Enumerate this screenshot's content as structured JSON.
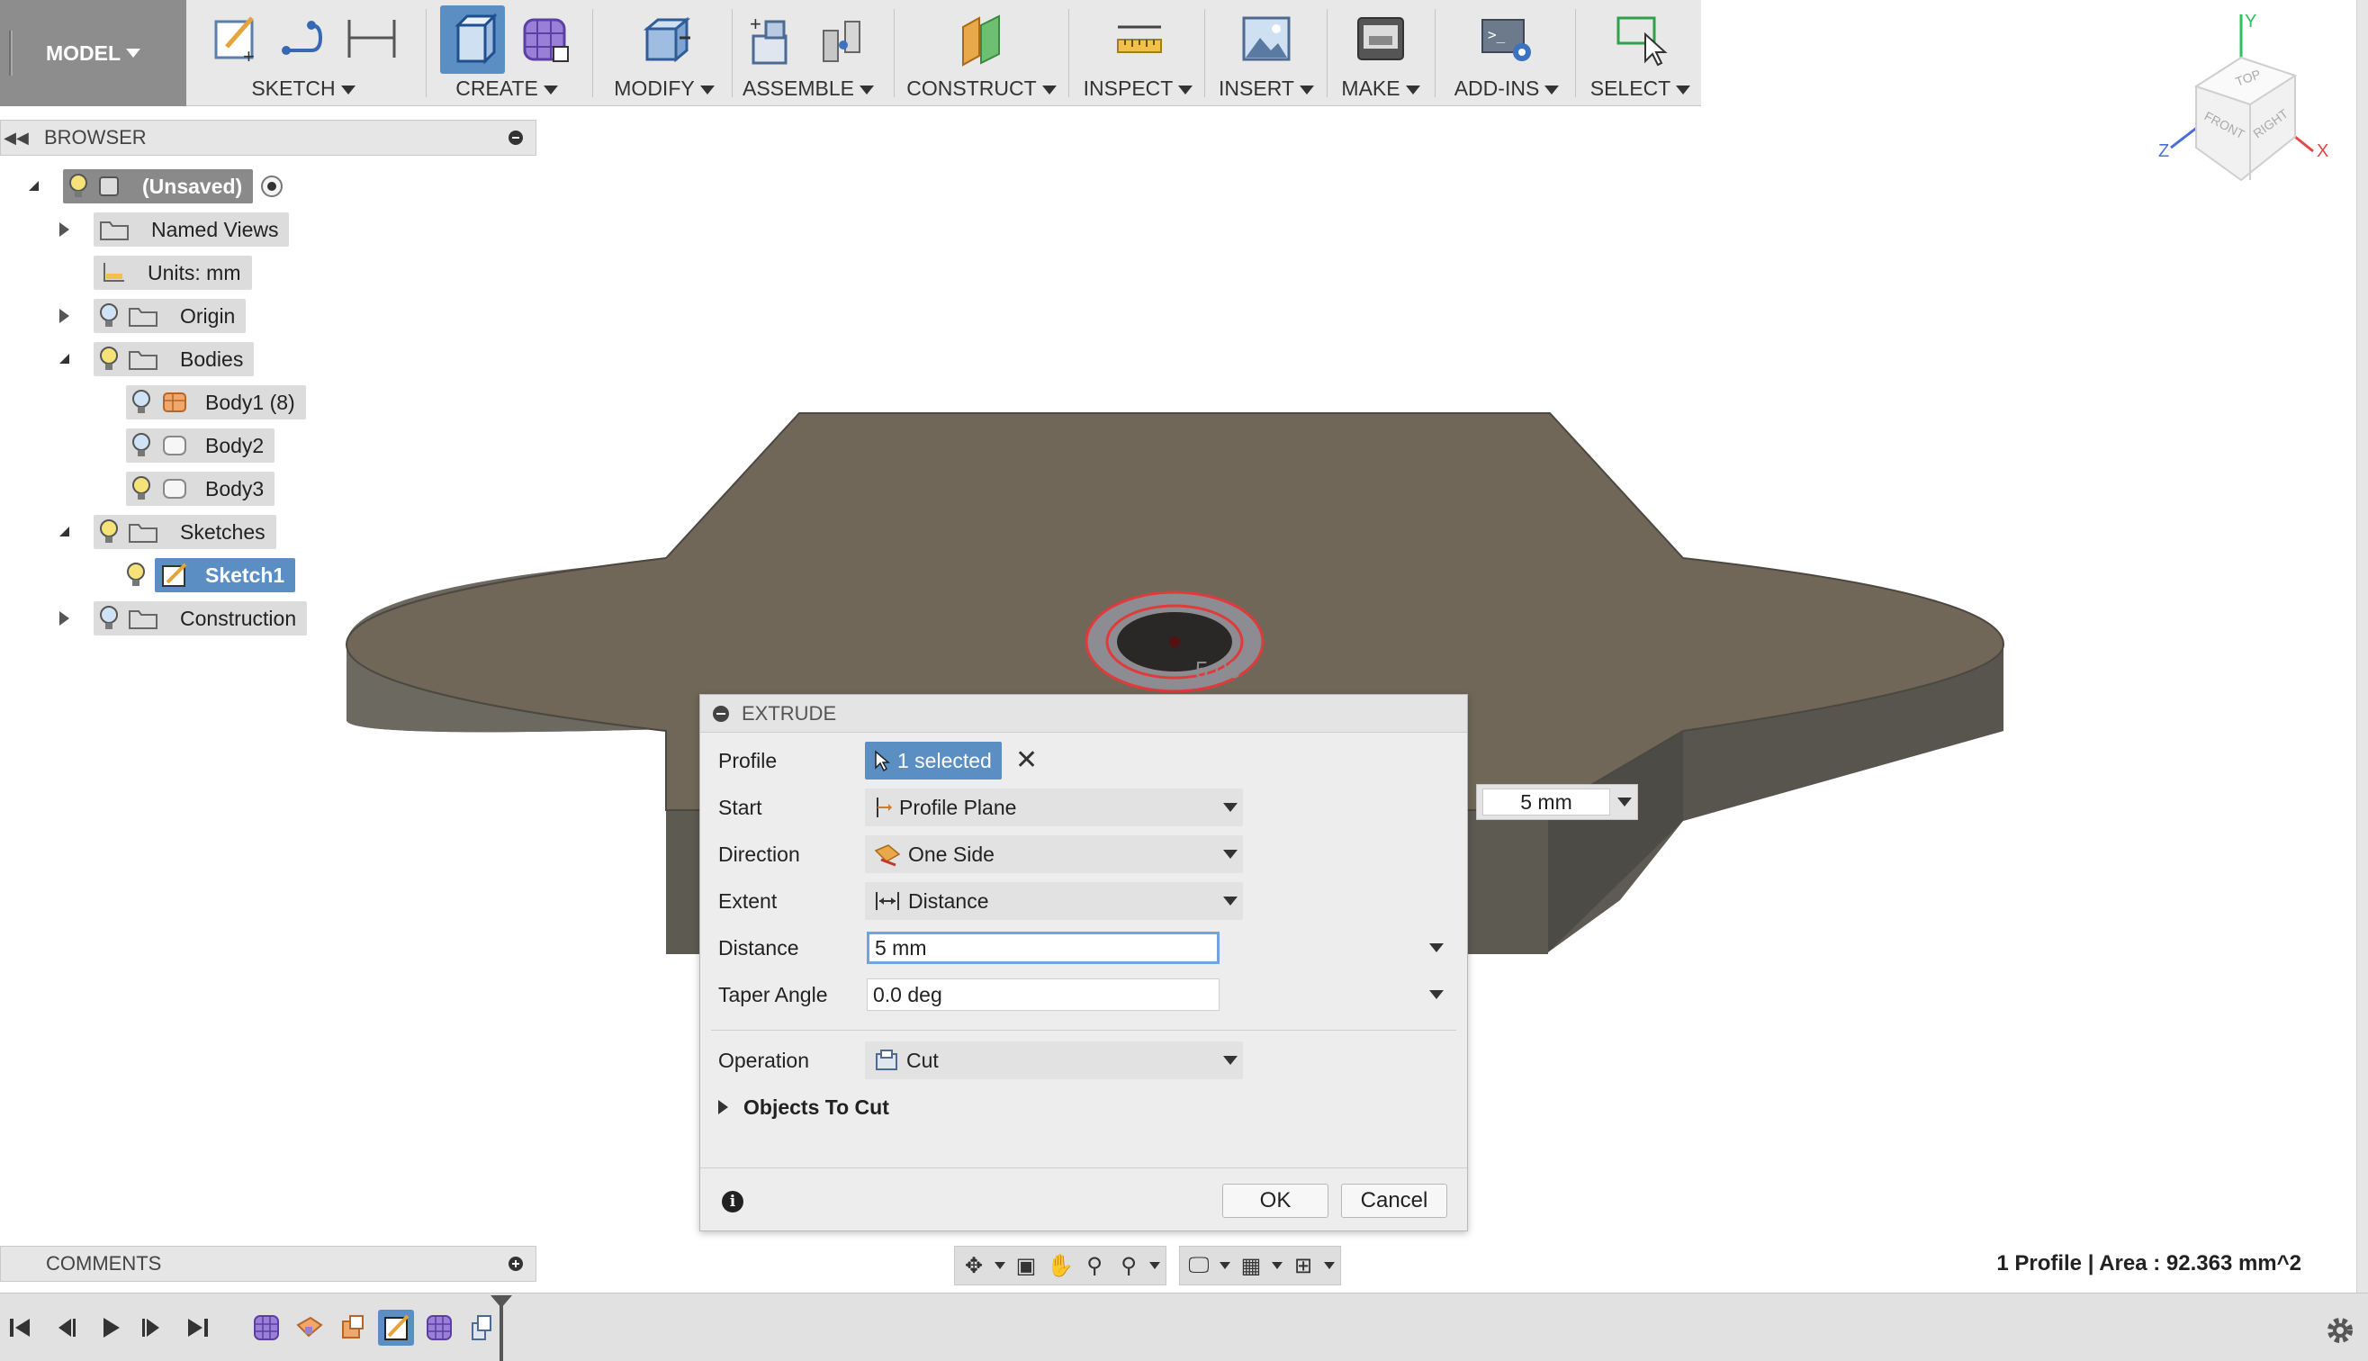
{
  "toolbar": {
    "workspace": "MODEL",
    "groups": [
      {
        "label": "SKETCH"
      },
      {
        "label": "CREATE"
      },
      {
        "label": "MODIFY"
      },
      {
        "label": "ASSEMBLE"
      },
      {
        "label": "CONSTRUCT"
      },
      {
        "label": "INSPECT"
      },
      {
        "label": "INSERT"
      },
      {
        "label": "MAKE"
      },
      {
        "label": "ADD-INS"
      },
      {
        "label": "SELECT"
      }
    ]
  },
  "browser": {
    "title": "BROWSER",
    "tree": {
      "root": "(Unsaved)",
      "named_views": "Named Views",
      "units": "Units: mm",
      "origin": "Origin",
      "bodies": "Bodies",
      "body1": "Body1 (8)",
      "body2": "Body2",
      "body3": "Body3",
      "sketches": "Sketches",
      "sketch1": "Sketch1",
      "construction": "Construction"
    }
  },
  "comments": {
    "title": "COMMENTS"
  },
  "extrude": {
    "title": "EXTRUDE",
    "profile_label": "Profile",
    "profile_value": "1 selected",
    "start_label": "Start",
    "start_value": "Profile Plane",
    "direction_label": "Direction",
    "direction_value": "One Side",
    "extent_label": "Extent",
    "extent_value": "Distance",
    "distance_label": "Distance",
    "distance_value": "5 mm",
    "taper_label": "Taper Angle",
    "taper_value": "0.0 deg",
    "operation_label": "Operation",
    "operation_value": "Cut",
    "objects_to_cut": "Objects To Cut",
    "ok": "OK",
    "cancel": "Cancel"
  },
  "viewport": {
    "floating_distance": "5 mm",
    "hole_dimension": "5.00"
  },
  "viewcube": {
    "top": "TOP",
    "front": "FRONT",
    "right": "RIGHT",
    "axis_x": "X",
    "axis_y": "Y",
    "axis_z": "Z"
  },
  "status": {
    "text": "1 Profile | Area : 92.363 mm^2"
  },
  "colors": {
    "accent": "#5b8fc4",
    "body_top": "#6f675b",
    "body_side": "#5d5a52",
    "selection_red": "#e03a3a"
  }
}
